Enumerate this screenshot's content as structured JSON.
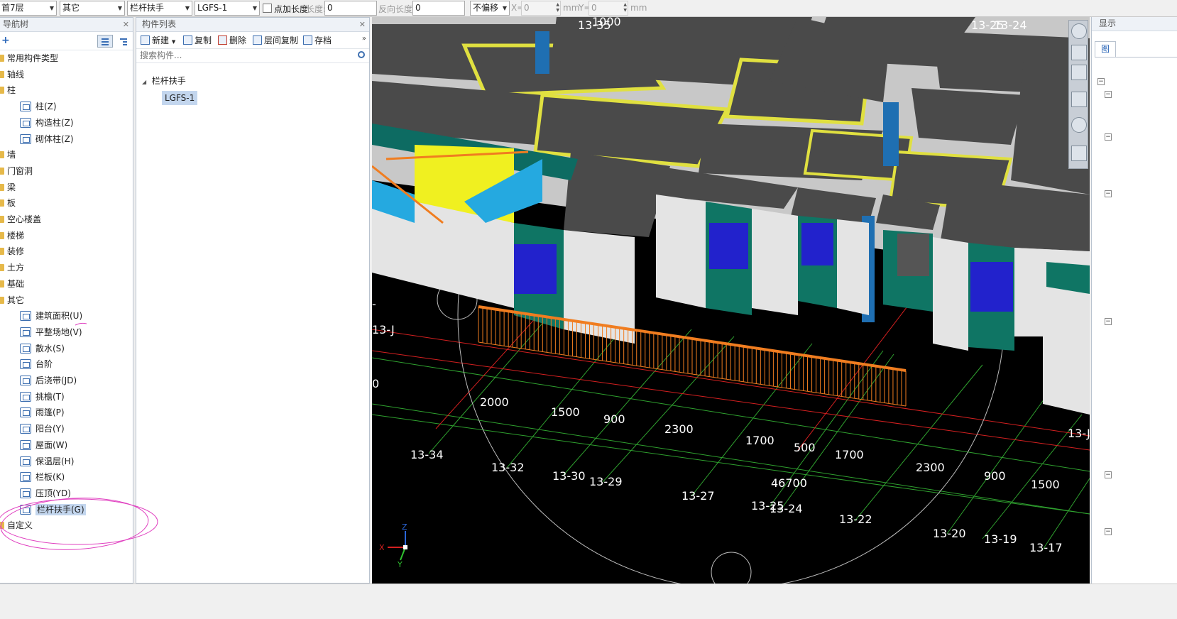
{
  "toolbar": {
    "floor": "首7层",
    "category": "其它",
    "component_type": "栏杆扶手",
    "component": "LGFS-1",
    "add_length_label": "点加长度",
    "length_label": "长度:",
    "length_value": "0",
    "reverse_length_label": "反向长度:",
    "reverse_length_value": "0",
    "offset": "不偏移",
    "x_label": "X=",
    "x_value": "0",
    "x_unit": "mm",
    "y_label": "Y=",
    "y_value": "0",
    "y_unit": "mm"
  },
  "nav": {
    "title": "导航树",
    "items": [
      {
        "label": "常用构件类型",
        "level": 0
      },
      {
        "label": "轴线",
        "level": 0
      },
      {
        "label": "柱",
        "level": 0
      },
      {
        "label": "柱(Z)",
        "level": 1
      },
      {
        "label": "构造柱(Z)",
        "level": 1
      },
      {
        "label": "砌体柱(Z)",
        "level": 1
      },
      {
        "label": "墙",
        "level": 0
      },
      {
        "label": "门窗洞",
        "level": 0
      },
      {
        "label": "梁",
        "level": 0
      },
      {
        "label": "板",
        "level": 0
      },
      {
        "label": "空心楼盖",
        "level": 0
      },
      {
        "label": "楼梯",
        "level": 0
      },
      {
        "label": "装修",
        "level": 0
      },
      {
        "label": "土方",
        "level": 0
      },
      {
        "label": "基础",
        "level": 0
      },
      {
        "label": "其它",
        "level": 0
      },
      {
        "label": "建筑面积(U)",
        "level": 1
      },
      {
        "label": "平整场地(V)",
        "level": 1
      },
      {
        "label": "散水(S)",
        "level": 1
      },
      {
        "label": "台阶",
        "level": 1
      },
      {
        "label": "后浇带(JD)",
        "level": 1
      },
      {
        "label": "挑檐(T)",
        "level": 1
      },
      {
        "label": "雨篷(P)",
        "level": 1
      },
      {
        "label": "阳台(Y)",
        "level": 1
      },
      {
        "label": "屋面(W)",
        "level": 1
      },
      {
        "label": "保温层(H)",
        "level": 1
      },
      {
        "label": "栏板(K)",
        "level": 1
      },
      {
        "label": "压顶(YD)",
        "level": 1
      },
      {
        "label": "栏杆扶手(G)",
        "level": 1,
        "selected": true
      },
      {
        "label": "自定义",
        "level": 0
      }
    ]
  },
  "component_list": {
    "title": "构件列表",
    "buttons": {
      "new": "新建",
      "copy": "复制",
      "delete": "删除",
      "floor_copy": "层间复制",
      "save": "存档"
    },
    "search_placeholder": "搜索构件...",
    "group": "栏杆扶手",
    "item": "LGFS-1"
  },
  "viewport": {
    "axis_labels": [
      "13-34",
      "13-32",
      "13-30",
      "13-29",
      "13-27",
      "13-25",
      "13-24",
      "13-22",
      "13-20",
      "13-19",
      "13-17",
      "13-25",
      "13-24",
      "13-35",
      "13-J",
      "13-J"
    ],
    "dimensions": [
      "2000",
      "1500",
      "900",
      "2300",
      "1700",
      "500",
      "1700",
      "2300",
      "900",
      "1500",
      "46700"
    ],
    "axis_letters": {
      "x": "X",
      "y": "Y",
      "z": "Z"
    },
    "edge_labels": [
      "1000",
      "0",
      "-"
    ]
  },
  "right_panel": {
    "title": "显示",
    "tab": "图"
  },
  "colors": {
    "accent": "#3d6fb0",
    "selection": "#c3d6ee",
    "viewport_bg": "#000000",
    "railing": "#f07d20",
    "grid_green": "#2fa12f",
    "grid_red": "#d42020",
    "annotation": "#e040c0"
  }
}
